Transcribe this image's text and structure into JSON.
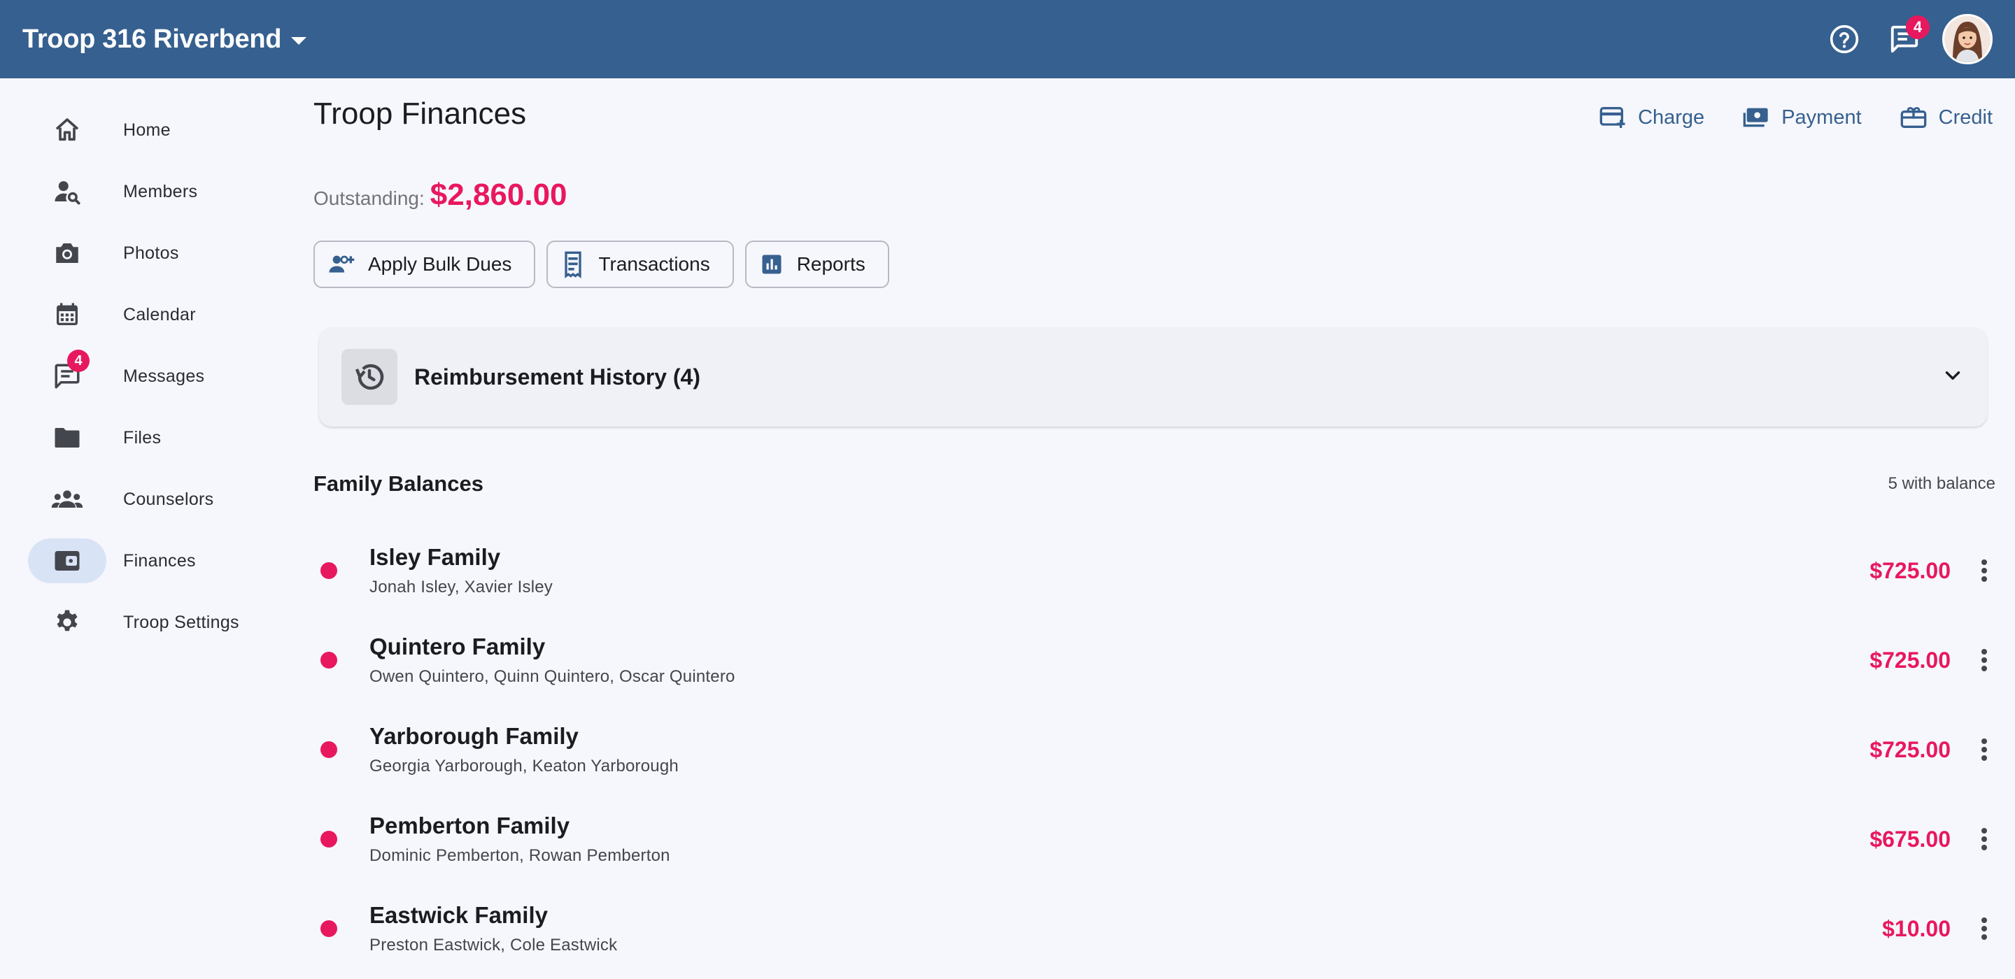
{
  "topbar": {
    "troop_name": "Troop 316 Riverbend",
    "messages_badge": "4"
  },
  "sidebar": {
    "items": [
      {
        "label": "Home",
        "icon": "home-icon"
      },
      {
        "label": "Members",
        "icon": "person-search-icon"
      },
      {
        "label": "Photos",
        "icon": "camera-icon"
      },
      {
        "label": "Calendar",
        "icon": "calendar-icon"
      },
      {
        "label": "Messages",
        "icon": "chat-icon",
        "badge": "4"
      },
      {
        "label": "Files",
        "icon": "folder-icon"
      },
      {
        "label": "Counselors",
        "icon": "groups-icon"
      },
      {
        "label": "Finances",
        "icon": "wallet-icon",
        "active": true
      },
      {
        "label": "Troop Settings",
        "icon": "gear-icon"
      }
    ]
  },
  "main": {
    "title": "Troop Finances",
    "actions": {
      "charge": "Charge",
      "payment": "Payment",
      "credit": "Credit"
    },
    "outstanding_label": "Outstanding:",
    "outstanding_value": "$2,860.00",
    "buttons": {
      "bulk_dues": "Apply Bulk Dues",
      "transactions": "Transactions",
      "reports": "Reports"
    },
    "reimbursement_title": "Reimbursement History (4)",
    "family_balances_title": "Family Balances",
    "with_balance": "5 with balance",
    "families": [
      {
        "name": "Isley Family",
        "members": "Jonah Isley, Xavier Isley",
        "amount": "$725.00"
      },
      {
        "name": "Quintero Family",
        "members": "Owen Quintero, Quinn Quintero, Oscar Quintero",
        "amount": "$725.00"
      },
      {
        "name": "Yarborough Family",
        "members": "Georgia Yarborough, Keaton Yarborough",
        "amount": "$725.00"
      },
      {
        "name": "Pemberton Family",
        "members": "Dominic Pemberton, Rowan Pemberton",
        "amount": "$675.00"
      },
      {
        "name": "Eastwick Family",
        "members": "Preston Eastwick, Cole Eastwick",
        "amount": "$10.00"
      }
    ]
  },
  "colors": {
    "header": "#36608f",
    "accent_pink": "#e8185e",
    "active_nav": "#d8e3f5",
    "link_blue": "#36608f"
  }
}
